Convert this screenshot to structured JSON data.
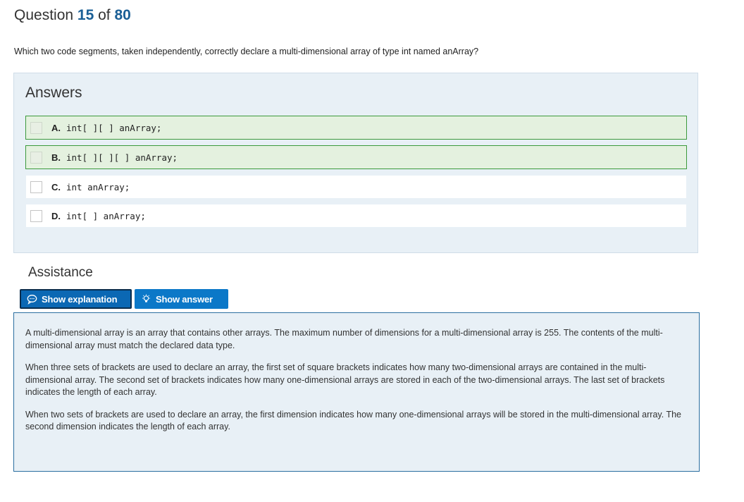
{
  "header": {
    "question_word": "Question",
    "current": "15",
    "of_word": "of",
    "total": "80"
  },
  "question": {
    "text": "Which two code segments, taken independently, correctly declare a multi-dimensional array of type int named anArray?"
  },
  "answers": {
    "title": "Answers",
    "options": [
      {
        "letter": "A.",
        "code": "int[ ][ ] anArray;",
        "correct": true
      },
      {
        "letter": "B.",
        "code": "int[ ][ ][ ] anArray;",
        "correct": true
      },
      {
        "letter": "C.",
        "code": "int anArray;",
        "correct": false
      },
      {
        "letter": "D.",
        "code": "int[ ] anArray;",
        "correct": false
      }
    ]
  },
  "assistance": {
    "title": "Assistance",
    "show_explanation_label": "Show explanation",
    "show_answer_label": "Show answer",
    "explanation_icon": "speech-bubble-icon",
    "answer_icon": "lightbulb-icon"
  },
  "explanation": {
    "paragraphs": [
      "A multi-dimensional array is an array that contains other arrays. The maximum number of dimensions for a multi-dimensional array is 255. The contents of the multi-dimensional array must match the declared data type.",
      "When three sets of brackets are used to declare an array, the first set of square brackets indicates how many two-dimensional arrays are contained in the multi-dimensional array. The second set of brackets indicates how many one-dimensional arrays are stored in each of the two-dimensional arrays. The last set of brackets indicates the length of each array.",
      "When two sets of brackets are used to declare an array, the first dimension indicates how many one-dimensional arrays will be stored in the multi-dimensional array. The second dimension indicates the length of each array."
    ]
  },
  "colors": {
    "accent": "#1a5f96",
    "button_blue": "#0b78c8",
    "correct_border": "#3c9a3c",
    "correct_bg": "#e4f1df",
    "panel_bg": "#e8f0f6"
  }
}
